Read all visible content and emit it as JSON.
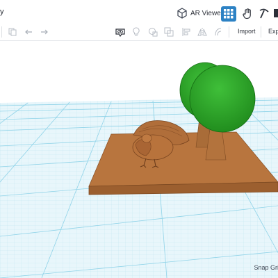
{
  "topbar": {
    "title_fragment": "y",
    "ar_viewer_label": "AR Viewer"
  },
  "toolbar": {
    "import_label": "Import",
    "export_label": "Expo"
  },
  "status": {
    "snap_grid_label": "Snap Grid"
  },
  "icons": [
    "ar-cube-icon",
    "grid-view-icon",
    "hand-pointer-icon",
    "pickaxe-icon",
    "copy-icon",
    "trash-icon",
    "undo-icon",
    "redo-icon",
    "view-icon",
    "light-bulb-icon",
    "shape-icon",
    "group-icon",
    "align-icon",
    "mirror-icon",
    "shape-tool-icon"
  ],
  "colors": {
    "accent": "#2d82c4",
    "grid_major": "#8fd3e8",
    "workplane": "#e8f6fb",
    "base_plate": "#b8753e",
    "tree_top": "#2ea52a",
    "trunk": "#a96c38"
  }
}
